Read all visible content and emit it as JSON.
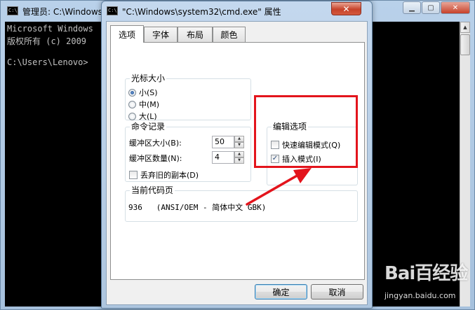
{
  "cmd_window": {
    "title": "管理员: C:\\Windows",
    "icon_text": "C:\\",
    "lines": [
      "Microsoft Windows",
      "版权所有 (c) 2009",
      "",
      "C:\\Users\\Lenovo>"
    ]
  },
  "dialog": {
    "title": "\"C:\\Windows\\system32\\cmd.exe\" 属性",
    "icon_text": "C:\\",
    "close_glyph": "✕",
    "tabs": [
      {
        "label": "选项"
      },
      {
        "label": "字体"
      },
      {
        "label": "布局"
      },
      {
        "label": "颜色"
      }
    ],
    "cursor_size": {
      "label": "光标大小",
      "options": [
        {
          "label": "小(S)",
          "selected": true
        },
        {
          "label": "中(M)",
          "selected": false
        },
        {
          "label": "大(L)",
          "selected": false
        }
      ]
    },
    "command_history": {
      "label": "命令记录",
      "buffer_size_label": "缓冲区大小(B):",
      "buffer_size_value": "50",
      "buffer_count_label": "缓冲区数量(N):",
      "buffer_count_value": "4",
      "discard_label": "丢弃旧的副本(D)",
      "discard_checked": false
    },
    "edit_options": {
      "label": "编辑选项",
      "quick_edit_label": "快速编辑模式(Q)",
      "quick_edit_checked": false,
      "insert_mode_label": "插入模式(I)",
      "insert_mode_checked": true
    },
    "code_page": {
      "label": "当前代码页",
      "value": "936   (ANSI/OEM - 简体中文 GBK)"
    },
    "ok_label": "确定",
    "cancel_label": "取消"
  },
  "annotation": {
    "color": "#e3141c"
  },
  "watermark": {
    "main": "Bai百经验",
    "sub": "jingyan.baidu.com"
  }
}
